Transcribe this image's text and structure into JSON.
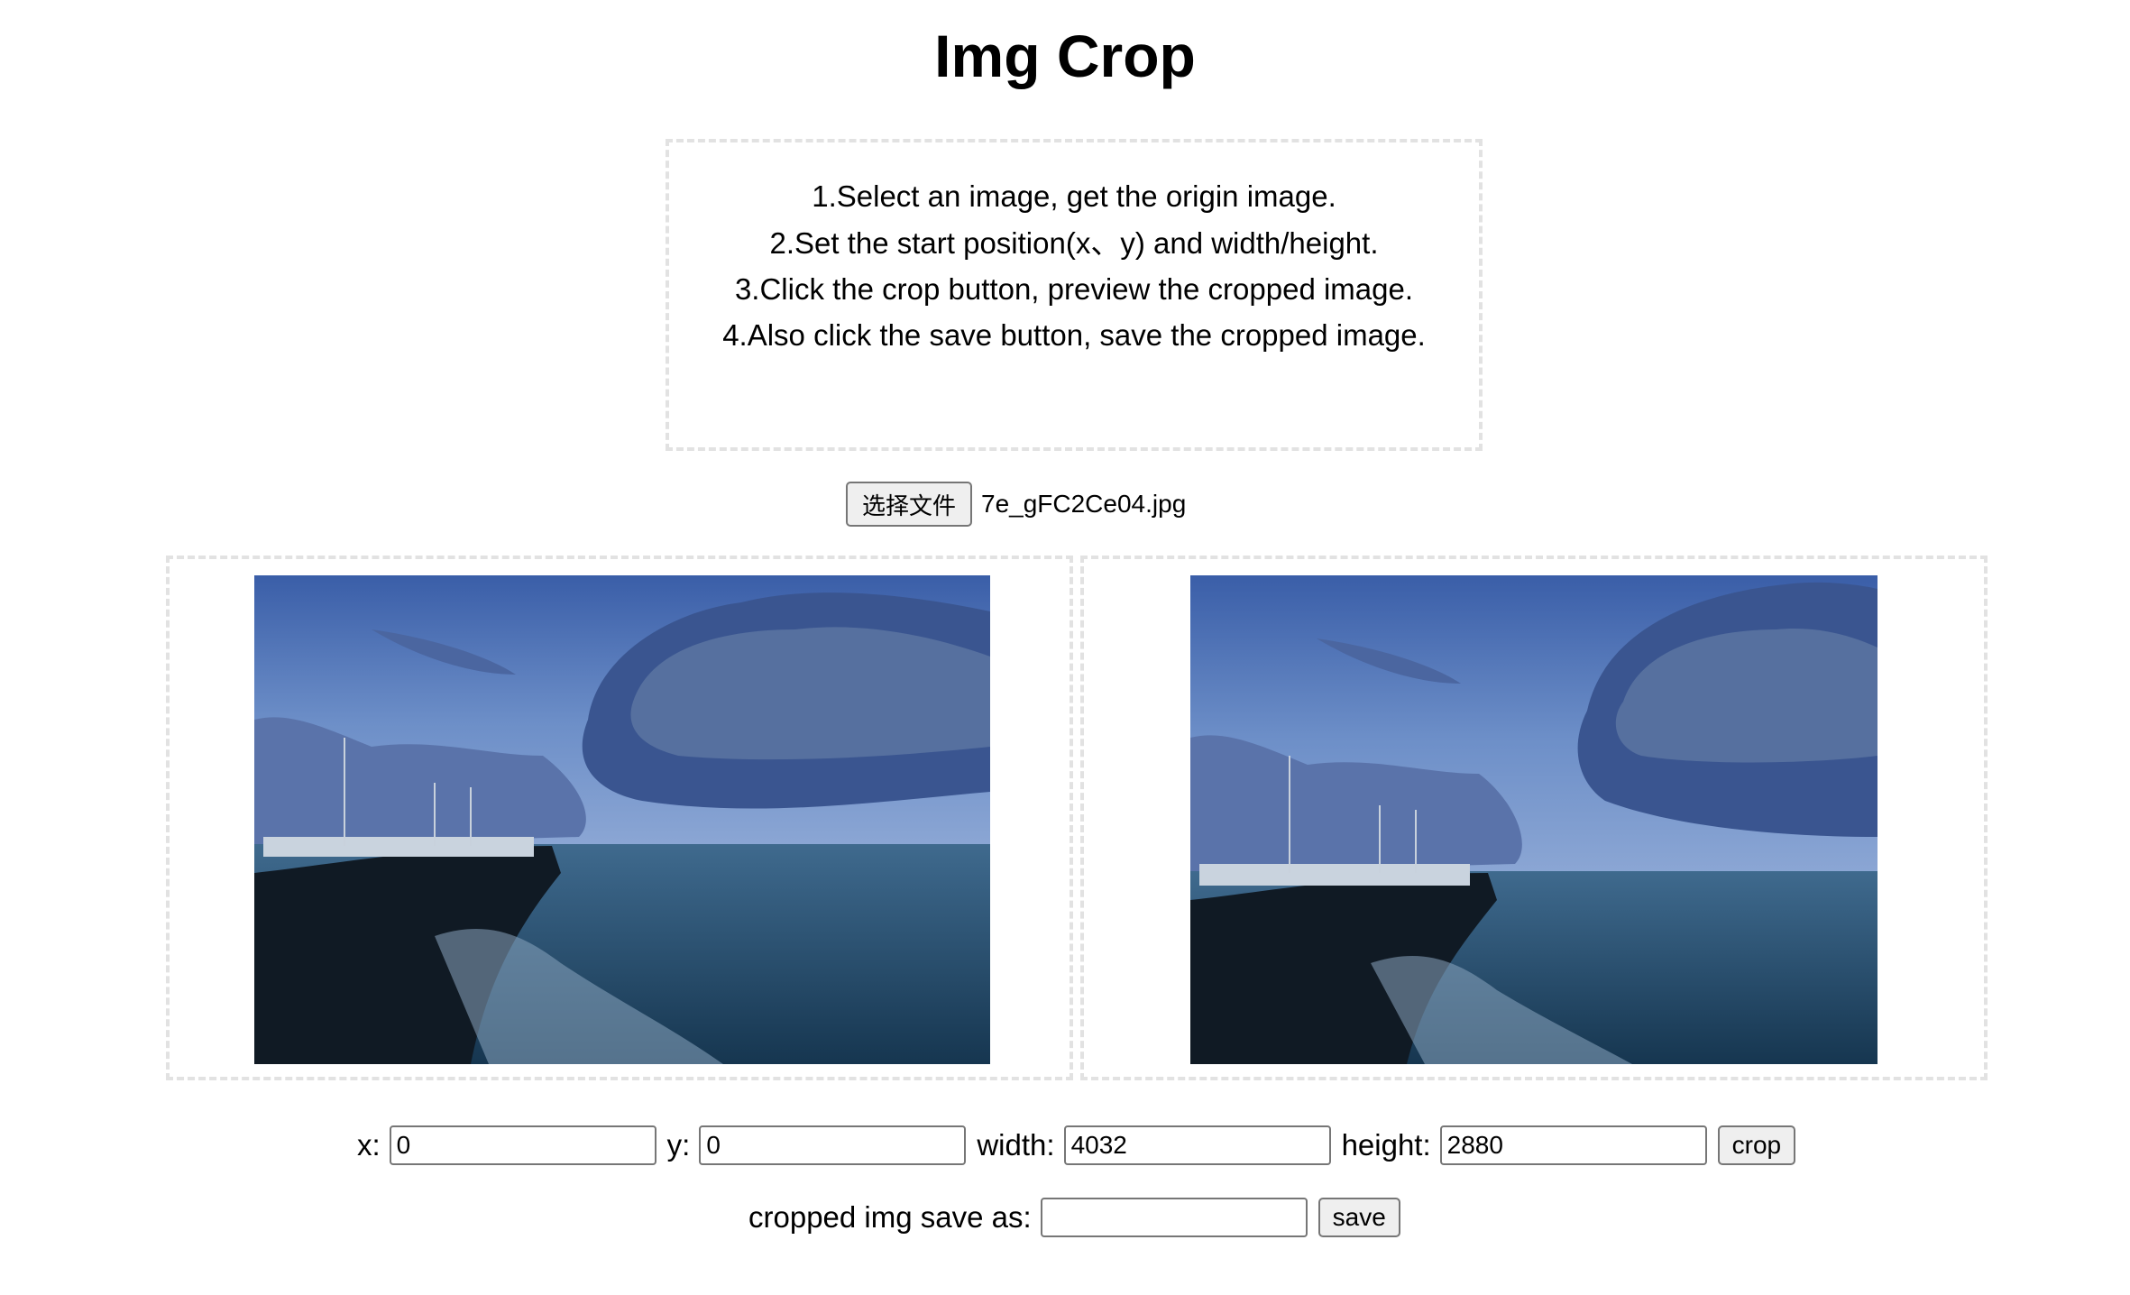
{
  "page": {
    "title": "Img Crop"
  },
  "instructions": [
    "1.Select an image, get the origin image.",
    "2.Set the start position(x、y) and width/height.",
    "3.Click the crop button, preview the cropped image.",
    "4.Also click the save button, save the cropped image."
  ],
  "file_picker": {
    "button_label": "选择文件",
    "file_name": "7e_gFC2Ce04.jpg"
  },
  "images": {
    "origin_icon": "image-photo-icon",
    "preview_icon": "image-photo-icon"
  },
  "crop_form": {
    "x_label": "x:",
    "x_value": "0",
    "y_label": "y:",
    "y_value": "0",
    "width_label": "width:",
    "width_value": "4032",
    "height_label": "height:",
    "height_value": "2880",
    "crop_button": "crop"
  },
  "save_form": {
    "label": "cropped img save as:",
    "value": "",
    "save_button": "save"
  }
}
